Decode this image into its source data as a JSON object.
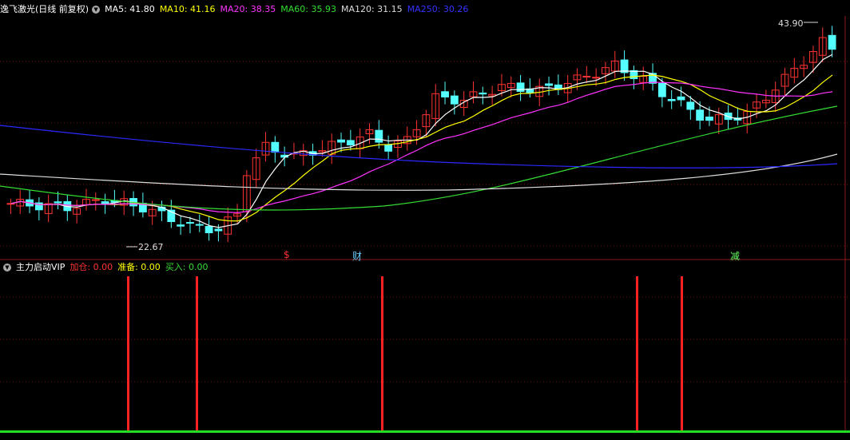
{
  "main_legend": {
    "title": "逸飞激光(日线 前复权)",
    "items": [
      {
        "label": "MA5: 41.80",
        "color": "#ffffff"
      },
      {
        "label": "MA10: 41.16",
        "color": "#ffff00"
      },
      {
        "label": "MA20: 38.35",
        "color": "#ff33ff"
      },
      {
        "label": "MA60: 35.93",
        "color": "#33dd33"
      },
      {
        "label": "MA120: 31.15",
        "color": "#dddddd"
      },
      {
        "label": "MA250: 30.26",
        "color": "#3333ff"
      }
    ]
  },
  "price_labels": {
    "high": "43.90",
    "low": "22.67"
  },
  "event_markers": [
    {
      "text": "$",
      "color": "#ff3333"
    },
    {
      "text": "财",
      "color": "#66ccff"
    },
    {
      "text": "减",
      "color": "#66ff66"
    }
  ],
  "sub_legend": {
    "title": "主力启动VIP",
    "items": [
      {
        "label": "加仓: 0.00",
        "color": "#ff3333"
      },
      {
        "label": "准备: 0.00",
        "color": "#ffff00"
      },
      {
        "label": "买入: 0.00",
        "color": "#33dd33"
      }
    ]
  },
  "colors": {
    "up": "#ff3333",
    "down": "#54ffff",
    "grid": "#7a1010"
  }
}
